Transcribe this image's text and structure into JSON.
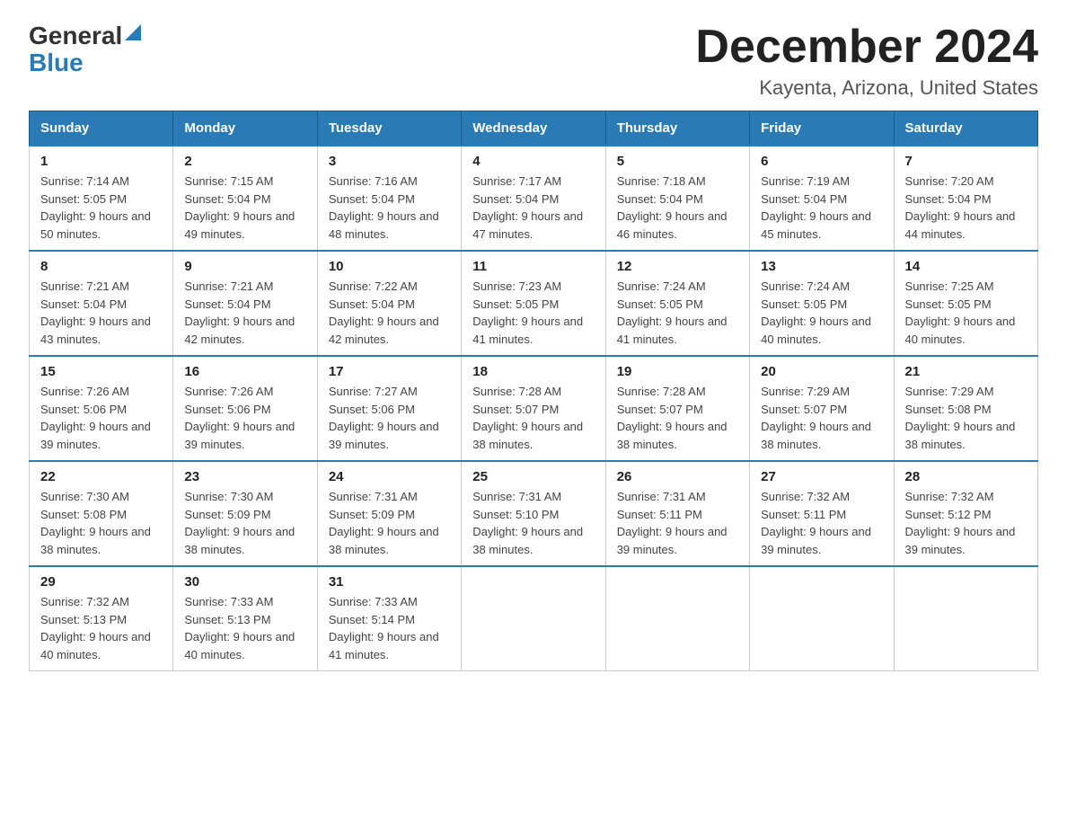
{
  "logo": {
    "general": "General",
    "blue": "Blue"
  },
  "title": "December 2024",
  "location": "Kayenta, Arizona, United States",
  "weekdays": [
    "Sunday",
    "Monday",
    "Tuesday",
    "Wednesday",
    "Thursday",
    "Friday",
    "Saturday"
  ],
  "weeks": [
    [
      {
        "day": "1",
        "sunrise": "7:14 AM",
        "sunset": "5:05 PM",
        "daylight": "9 hours and 50 minutes."
      },
      {
        "day": "2",
        "sunrise": "7:15 AM",
        "sunset": "5:04 PM",
        "daylight": "9 hours and 49 minutes."
      },
      {
        "day": "3",
        "sunrise": "7:16 AM",
        "sunset": "5:04 PM",
        "daylight": "9 hours and 48 minutes."
      },
      {
        "day": "4",
        "sunrise": "7:17 AM",
        "sunset": "5:04 PM",
        "daylight": "9 hours and 47 minutes."
      },
      {
        "day": "5",
        "sunrise": "7:18 AM",
        "sunset": "5:04 PM",
        "daylight": "9 hours and 46 minutes."
      },
      {
        "day": "6",
        "sunrise": "7:19 AM",
        "sunset": "5:04 PM",
        "daylight": "9 hours and 45 minutes."
      },
      {
        "day": "7",
        "sunrise": "7:20 AM",
        "sunset": "5:04 PM",
        "daylight": "9 hours and 44 minutes."
      }
    ],
    [
      {
        "day": "8",
        "sunrise": "7:21 AM",
        "sunset": "5:04 PM",
        "daylight": "9 hours and 43 minutes."
      },
      {
        "day": "9",
        "sunrise": "7:21 AM",
        "sunset": "5:04 PM",
        "daylight": "9 hours and 42 minutes."
      },
      {
        "day": "10",
        "sunrise": "7:22 AM",
        "sunset": "5:04 PM",
        "daylight": "9 hours and 42 minutes."
      },
      {
        "day": "11",
        "sunrise": "7:23 AM",
        "sunset": "5:05 PM",
        "daylight": "9 hours and 41 minutes."
      },
      {
        "day": "12",
        "sunrise": "7:24 AM",
        "sunset": "5:05 PM",
        "daylight": "9 hours and 41 minutes."
      },
      {
        "day": "13",
        "sunrise": "7:24 AM",
        "sunset": "5:05 PM",
        "daylight": "9 hours and 40 minutes."
      },
      {
        "day": "14",
        "sunrise": "7:25 AM",
        "sunset": "5:05 PM",
        "daylight": "9 hours and 40 minutes."
      }
    ],
    [
      {
        "day": "15",
        "sunrise": "7:26 AM",
        "sunset": "5:06 PM",
        "daylight": "9 hours and 39 minutes."
      },
      {
        "day": "16",
        "sunrise": "7:26 AM",
        "sunset": "5:06 PM",
        "daylight": "9 hours and 39 minutes."
      },
      {
        "day": "17",
        "sunrise": "7:27 AM",
        "sunset": "5:06 PM",
        "daylight": "9 hours and 39 minutes."
      },
      {
        "day": "18",
        "sunrise": "7:28 AM",
        "sunset": "5:07 PM",
        "daylight": "9 hours and 38 minutes."
      },
      {
        "day": "19",
        "sunrise": "7:28 AM",
        "sunset": "5:07 PM",
        "daylight": "9 hours and 38 minutes."
      },
      {
        "day": "20",
        "sunrise": "7:29 AM",
        "sunset": "5:07 PM",
        "daylight": "9 hours and 38 minutes."
      },
      {
        "day": "21",
        "sunrise": "7:29 AM",
        "sunset": "5:08 PM",
        "daylight": "9 hours and 38 minutes."
      }
    ],
    [
      {
        "day": "22",
        "sunrise": "7:30 AM",
        "sunset": "5:08 PM",
        "daylight": "9 hours and 38 minutes."
      },
      {
        "day": "23",
        "sunrise": "7:30 AM",
        "sunset": "5:09 PM",
        "daylight": "9 hours and 38 minutes."
      },
      {
        "day": "24",
        "sunrise": "7:31 AM",
        "sunset": "5:09 PM",
        "daylight": "9 hours and 38 minutes."
      },
      {
        "day": "25",
        "sunrise": "7:31 AM",
        "sunset": "5:10 PM",
        "daylight": "9 hours and 38 minutes."
      },
      {
        "day": "26",
        "sunrise": "7:31 AM",
        "sunset": "5:11 PM",
        "daylight": "9 hours and 39 minutes."
      },
      {
        "day": "27",
        "sunrise": "7:32 AM",
        "sunset": "5:11 PM",
        "daylight": "9 hours and 39 minutes."
      },
      {
        "day": "28",
        "sunrise": "7:32 AM",
        "sunset": "5:12 PM",
        "daylight": "9 hours and 39 minutes."
      }
    ],
    [
      {
        "day": "29",
        "sunrise": "7:32 AM",
        "sunset": "5:13 PM",
        "daylight": "9 hours and 40 minutes."
      },
      {
        "day": "30",
        "sunrise": "7:33 AM",
        "sunset": "5:13 PM",
        "daylight": "9 hours and 40 minutes."
      },
      {
        "day": "31",
        "sunrise": "7:33 AM",
        "sunset": "5:14 PM",
        "daylight": "9 hours and 41 minutes."
      },
      null,
      null,
      null,
      null
    ]
  ]
}
